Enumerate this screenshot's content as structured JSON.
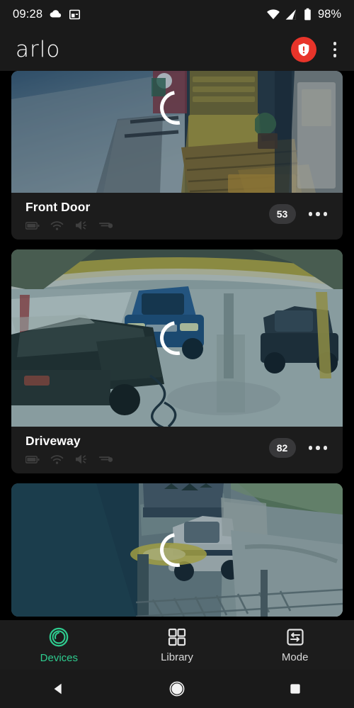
{
  "status_bar": {
    "time": "09:28",
    "battery_percent": "98%",
    "left_icons": [
      "cloud-icon",
      "calendar-notification-icon"
    ],
    "right_icons": [
      "wifi-icon",
      "cellular-signal-icon",
      "battery-icon"
    ]
  },
  "header": {
    "logo_text": "arlo",
    "alert_icon": "shield-alert-icon",
    "alert_color": "#e8342a",
    "overflow_icon": "kebab-menu-icon"
  },
  "cameras": [
    {
      "name": "Front Door",
      "badge": "53",
      "loading": true,
      "status_icons": [
        "battery-icon",
        "wifi-icon",
        "speaker-icon",
        "sensitivity-icon"
      ],
      "more_icon": "more-options-icon"
    },
    {
      "name": "Driveway",
      "badge": "82",
      "loading": true,
      "status_icons": [
        "battery-icon",
        "wifi-icon",
        "speaker-icon",
        "sensitivity-icon"
      ],
      "more_icon": "more-options-icon"
    },
    {
      "name": "",
      "badge": "",
      "loading": true,
      "status_icons": [],
      "more_icon": ""
    }
  ],
  "bottom_nav": {
    "active_color": "#2ecc8f",
    "inactive_color": "#d8d8d8",
    "tabs": [
      {
        "label": "Devices",
        "icon": "devices-ring-icon",
        "active": true
      },
      {
        "label": "Library",
        "icon": "grid-icon",
        "active": false
      },
      {
        "label": "Mode",
        "icon": "mode-sliders-icon",
        "active": false
      }
    ]
  },
  "system_nav": {
    "back": "back-triangle-icon",
    "home": "home-circle-icon",
    "recents": "recents-square-icon"
  }
}
